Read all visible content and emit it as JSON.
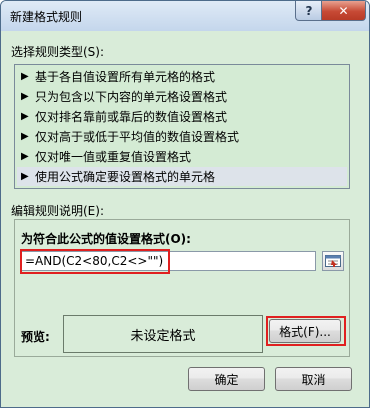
{
  "window": {
    "title": "新建格式规则",
    "help_label": "?",
    "close_label": "✕"
  },
  "rule_type": {
    "label": "选择规则类型(S):",
    "items": [
      {
        "label": "基于各自值设置所有单元格的格式"
      },
      {
        "label": "只为包含以下内容的单元格设置格式"
      },
      {
        "label": "仅对排名靠前或靠后的数值设置格式"
      },
      {
        "label": "仅对高于或低于平均值的数值设置格式"
      },
      {
        "label": "仅对唯一值或重复值设置格式"
      },
      {
        "label": "使用公式确定要设置格式的单元格",
        "selected": true
      }
    ],
    "bullet": "▶"
  },
  "description": {
    "label": "编辑规则说明(E):",
    "formula_heading": "为符合此公式的值设置格式(O):",
    "formula_value": "=AND(C2<80,C2<>\"\")",
    "preview_label": "预览:",
    "preview_text": "未设定格式",
    "format_button": "格式(F)..."
  },
  "footer": {
    "ok_label": "确定",
    "cancel_label": "取消"
  },
  "colors": {
    "dialog_bg": "#d9ecd9",
    "highlight": "#e02020",
    "selected_row": "#dde3ea"
  }
}
